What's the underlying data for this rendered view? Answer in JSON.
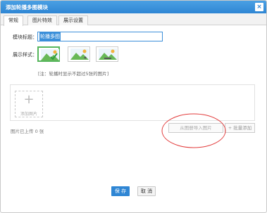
{
  "dialog": {
    "title": "添加轮播多图模块",
    "close_label": "×"
  },
  "tabs": [
    {
      "label": "常规",
      "active": true
    },
    {
      "label": "图片特效",
      "active": false
    },
    {
      "label": "展示设置",
      "active": false
    }
  ],
  "form": {
    "name_label": "模块标题：",
    "name_value": "轮播多图",
    "style_label": "展示样式：",
    "style_options": [
      {
        "icon": "carousel-style-1-icon",
        "selected": true
      },
      {
        "icon": "carousel-style-2-icon",
        "selected": false
      },
      {
        "icon": "carousel-style-3-icon",
        "selected": false
      }
    ],
    "note": "[注：轮播时显示不超过5张的图片]"
  },
  "upload": {
    "plus": "+",
    "add_label": "添加图片",
    "count_text": "图片已上传 0 张",
    "from_library_label": "从图册导入图片",
    "quick_add_label": "+ 批量添加"
  },
  "footer": {
    "save_label": "保 存",
    "cancel_label": "取 消"
  },
  "colors": {
    "titlebar": "#2f86d4",
    "selected_border": "#56b65c",
    "annotation": "#e23b3b"
  }
}
